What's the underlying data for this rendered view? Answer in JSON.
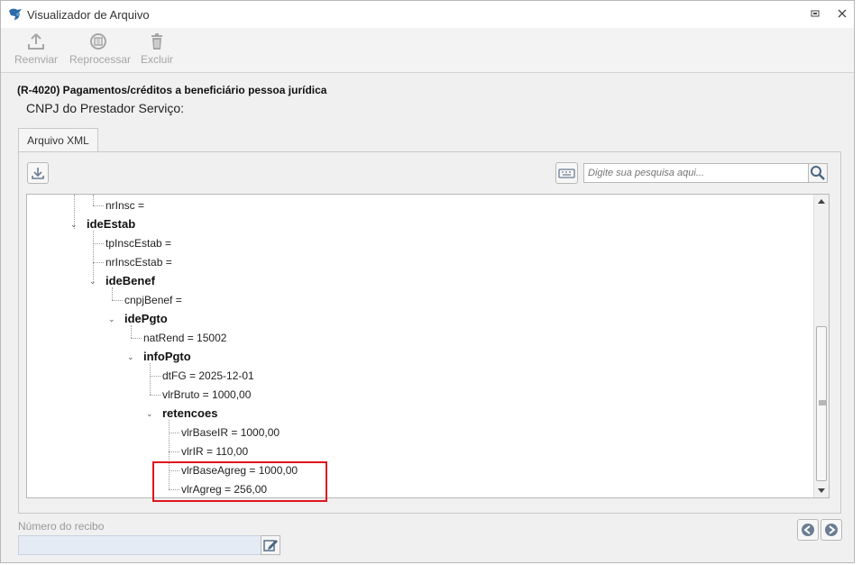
{
  "window": {
    "title": "Visualizador de Arquivo"
  },
  "toolbar": {
    "reenviar": "Reenviar",
    "reprocessar": "Reprocessar",
    "excluir": "Excluir"
  },
  "header": {
    "title": "(R-4020) Pagamentos/créditos a beneficiário pessoa jurídica",
    "subtitle": "CNPJ do Prestador Serviço:"
  },
  "tabs": [
    {
      "label": "Arquivo XML"
    }
  ],
  "search": {
    "placeholder": "Digite sua pesquisa aqui..."
  },
  "tree": {
    "nodes": [
      {
        "label": "nrInsc ="
      },
      {
        "label": "ideEstab"
      },
      {
        "label": "tpInscEstab ="
      },
      {
        "label": "nrInscEstab ="
      },
      {
        "label": "ideBenef"
      },
      {
        "label": "cnpjBenef ="
      },
      {
        "label": "idePgto"
      },
      {
        "label": "natRend = 15002"
      },
      {
        "label": "infoPgto"
      },
      {
        "label": "dtFG = 2025-12-01"
      },
      {
        "label": "vlrBruto = 1000,00"
      },
      {
        "label": "retencoes"
      },
      {
        "label": "vlrBaseIR = 1000,00"
      },
      {
        "label": "vlrIR = 110,00"
      },
      {
        "label": "vlrBaseAgreg = 1000,00"
      },
      {
        "label": "vlrAgreg = 256,00"
      }
    ]
  },
  "footer": {
    "recibo_label": "Número do recibo"
  },
  "colors": {
    "highlight": "#e0161c",
    "input_bg": "#e4ebf5"
  },
  "icons": [
    "app-icon",
    "maximize-icon",
    "close-icon",
    "upload-icon",
    "reprocess-icon",
    "trash-icon",
    "download-icon",
    "keyboard-icon",
    "search-icon",
    "edit-icon",
    "arrow-left-icon",
    "arrow-right-icon"
  ]
}
